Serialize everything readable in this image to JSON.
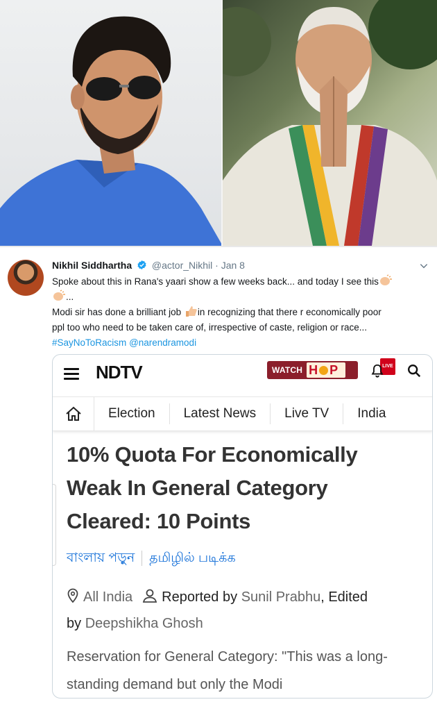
{
  "photos": {
    "left_alt": "",
    "right_alt": ""
  },
  "tweet": {
    "name": "Nikhil Siddhartha",
    "handle": "@actor_Nikhil",
    "dot": "·",
    "date": "Jan 8",
    "line1": "Spoke about this in Rana's yaari show a few weeks back... and today I see this",
    "line2_suffix": "...",
    "line3_a": "Modi sir has done a brilliant job ",
    "line3_b": "in recognizing that there r economically poor",
    "line4": "ppl too who need to be taken care of, irrespective of caste, religion or race...",
    "hashtag": "#SayNoToRacism",
    "mention": "@narendramodi"
  },
  "card": {
    "logo": "NDTV",
    "watch_label": "WATCH",
    "hop_h": "H",
    "hop_p": "P",
    "live_badge": "LIVE",
    "nav": [
      "Election",
      "Latest News",
      "Live TV",
      "India"
    ],
    "headline": "10% Quota For Economically Weak In General Category Cleared: 10 Points",
    "lang_bengali": "বাংলায় পড়ুন",
    "lang_tamil": "தமிழில் படிக்க",
    "location": "All India",
    "reported_by_label": "Reported by",
    "reporter": "Sunil Prabhu",
    "edited_label": ", Edited",
    "by_label": "by",
    "editor": "Deepshikha Ghosh",
    "summary": "Reservation for General Category: \"This was a long-standing demand but only the Modi"
  },
  "colors": {
    "link": "#1b95e0",
    "ndtv_watch_bg": "#8b1f2b",
    "lang_link": "#1a73d9"
  }
}
